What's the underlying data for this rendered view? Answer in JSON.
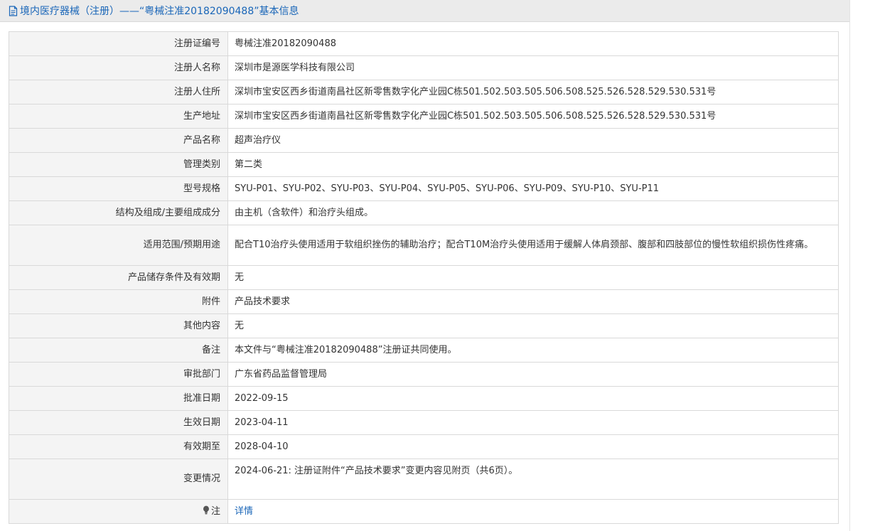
{
  "header": {
    "title": "境内医疗器械（注册）——“粤械注准20182090488”基本信息",
    "icon": "document-icon"
  },
  "rows": [
    {
      "label": "注册证编号",
      "value": "粤械注准20182090488"
    },
    {
      "label": "注册人名称",
      "value": "深圳市是源医学科技有限公司"
    },
    {
      "label": "注册人住所",
      "value": "深圳市宝安区西乡街道南昌社区新零售数字化产业园C栋501.502.503.505.506.508.525.526.528.529.530.531号"
    },
    {
      "label": "生产地址",
      "value": "深圳市宝安区西乡街道南昌社区新零售数字化产业园C栋501.502.503.505.506.508.525.526.528.529.530.531号"
    },
    {
      "label": "产品名称",
      "value": "超声治疗仪"
    },
    {
      "label": "管理类别",
      "value": "第二类"
    },
    {
      "label": "型号规格",
      "value": "SYU-P01、SYU-P02、SYU-P03、SYU-P04、SYU-P05、SYU-P06、SYU-P09、SYU-P10、SYU-P11"
    },
    {
      "label": "结构及组成/主要组成成分",
      "value": "由主机（含软件）和治疗头组成。"
    },
    {
      "label": "适用范围/预期用途",
      "value": "配合T10治疗头使用适用于软组织挫伤的辅助治疗；配合T10M治疗头使用适用于缓解人体肩颈部、腹部和四肢部位的慢性软组织损伤性疼痛。"
    },
    {
      "label": "产品储存条件及有效期",
      "value": "无"
    },
    {
      "label": "附件",
      "value": "产品技术要求"
    },
    {
      "label": "其他内容",
      "value": "无"
    },
    {
      "label": "备注",
      "value": "本文件与“粤械注准20182090488”注册证共同使用。"
    },
    {
      "label": "审批部门",
      "value": "广东省药品监督管理局"
    },
    {
      "label": "批准日期",
      "value": "2022-09-15"
    },
    {
      "label": "生效日期",
      "value": "2023-04-11"
    },
    {
      "label": "有效期至",
      "value": "2028-04-10"
    },
    {
      "label": "变更情况",
      "value": "2024-06-21: 注册证附件“产品技术要求”变更内容见附页（共6页）。"
    }
  ],
  "note": {
    "label": "注",
    "icon": "bulb-icon",
    "link_text": "详情"
  },
  "colors": {
    "accent": "#1a66b8",
    "label_bg": "#f4f4f4",
    "border": "#d9d9d9",
    "title_bg": "#ebebeb"
  }
}
